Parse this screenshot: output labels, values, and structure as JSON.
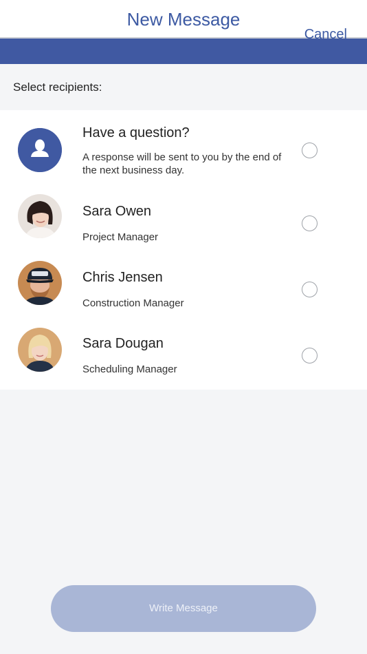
{
  "header": {
    "title": "New Message",
    "cancel_label": "Cancel"
  },
  "section": {
    "label": "Select recipients:"
  },
  "recipients": [
    {
      "name": "Have a question?",
      "subtitle": "A response will be sent to you by the end of the next business day.",
      "avatar": "person-icon",
      "selected": false
    },
    {
      "name": "Sara Owen",
      "subtitle": "Project Manager",
      "avatar": "photo",
      "selected": false
    },
    {
      "name": "Chris Jensen",
      "subtitle": "Construction Manager",
      "avatar": "photo",
      "selected": false
    },
    {
      "name": "Sara Dougan",
      "subtitle": "Scheduling Manager",
      "avatar": "photo",
      "selected": false
    }
  ],
  "footer": {
    "write_label": "Write Message"
  },
  "colors": {
    "brand": "#4059a2",
    "button_disabled": "#a9b6d6",
    "background": "#f4f5f7"
  }
}
